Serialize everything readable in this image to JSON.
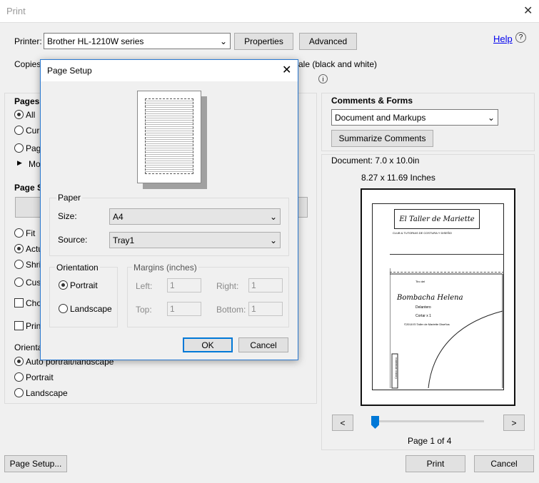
{
  "window": {
    "title": "Print"
  },
  "printer": {
    "label": "Printer:",
    "value": "Brother HL-1210W series",
    "properties": "Properties",
    "advanced": "Advanced",
    "help": "Help"
  },
  "copies": {
    "label": "Copies",
    "grayscale": "ale (black and white)"
  },
  "pages": {
    "header": "Pages",
    "all": "All",
    "current": "Cur",
    "pages": "Pag",
    "more": "Mo"
  },
  "page_sizing": {
    "header": "Page S",
    "fit": "Fit",
    "actual": "Actu",
    "shrink": "Shri",
    "custom": "Cus",
    "choose": "Cho"
  },
  "print_both": {
    "label": "Prin"
  },
  "orientation": {
    "header": "Orienta",
    "auto": "Auto portrait/landscape",
    "portrait": "Portrait",
    "landscape": "Landscape"
  },
  "comments_forms": {
    "header": "Comments & Forms",
    "value": "Document and Markups",
    "summarize": "Summarize Comments"
  },
  "document": {
    "size": "Document: 7.0 x 10.0in",
    "paper": "8.27 x 11.69 Inches"
  },
  "preview": {
    "logo": "El Taller de Mariette",
    "subtitle": "CLUB & TUTORIAS DE COSTURA Y DISEÑO",
    "title": "Bombacha Helena",
    "line1": "Delantero",
    "line2": "Cortar x 1",
    "line3": "©2018 El Taller de Mariette Diseños",
    "side": "Centro delantero",
    "top": "Tiro del"
  },
  "pager": {
    "prev": "<",
    "next": ">",
    "page_text": "Page 1 of 4",
    "slider_fraction": 0
  },
  "bottom": {
    "page_setup": "Page Setup...",
    "print": "Print",
    "cancel": "Cancel"
  },
  "dialog": {
    "title": "Page Setup",
    "paper_header": "Paper",
    "size_label": "Size:",
    "size_value": "A4",
    "source_label": "Source:",
    "source_value": "Tray1",
    "orientation_header": "Orientation",
    "portrait": "Portrait",
    "landscape": "Landscape",
    "margins_header": "Margins (inches)",
    "left_label": "Left:",
    "right_label": "Right:",
    "top_label": "Top:",
    "bottom_label": "Bottom:",
    "left": "1",
    "right": "1",
    "top": "1",
    "bottom": "1",
    "ok": "OK",
    "cancel": "Cancel"
  },
  "colors": {
    "accent": "#0078d7",
    "link": "#0000ee"
  }
}
